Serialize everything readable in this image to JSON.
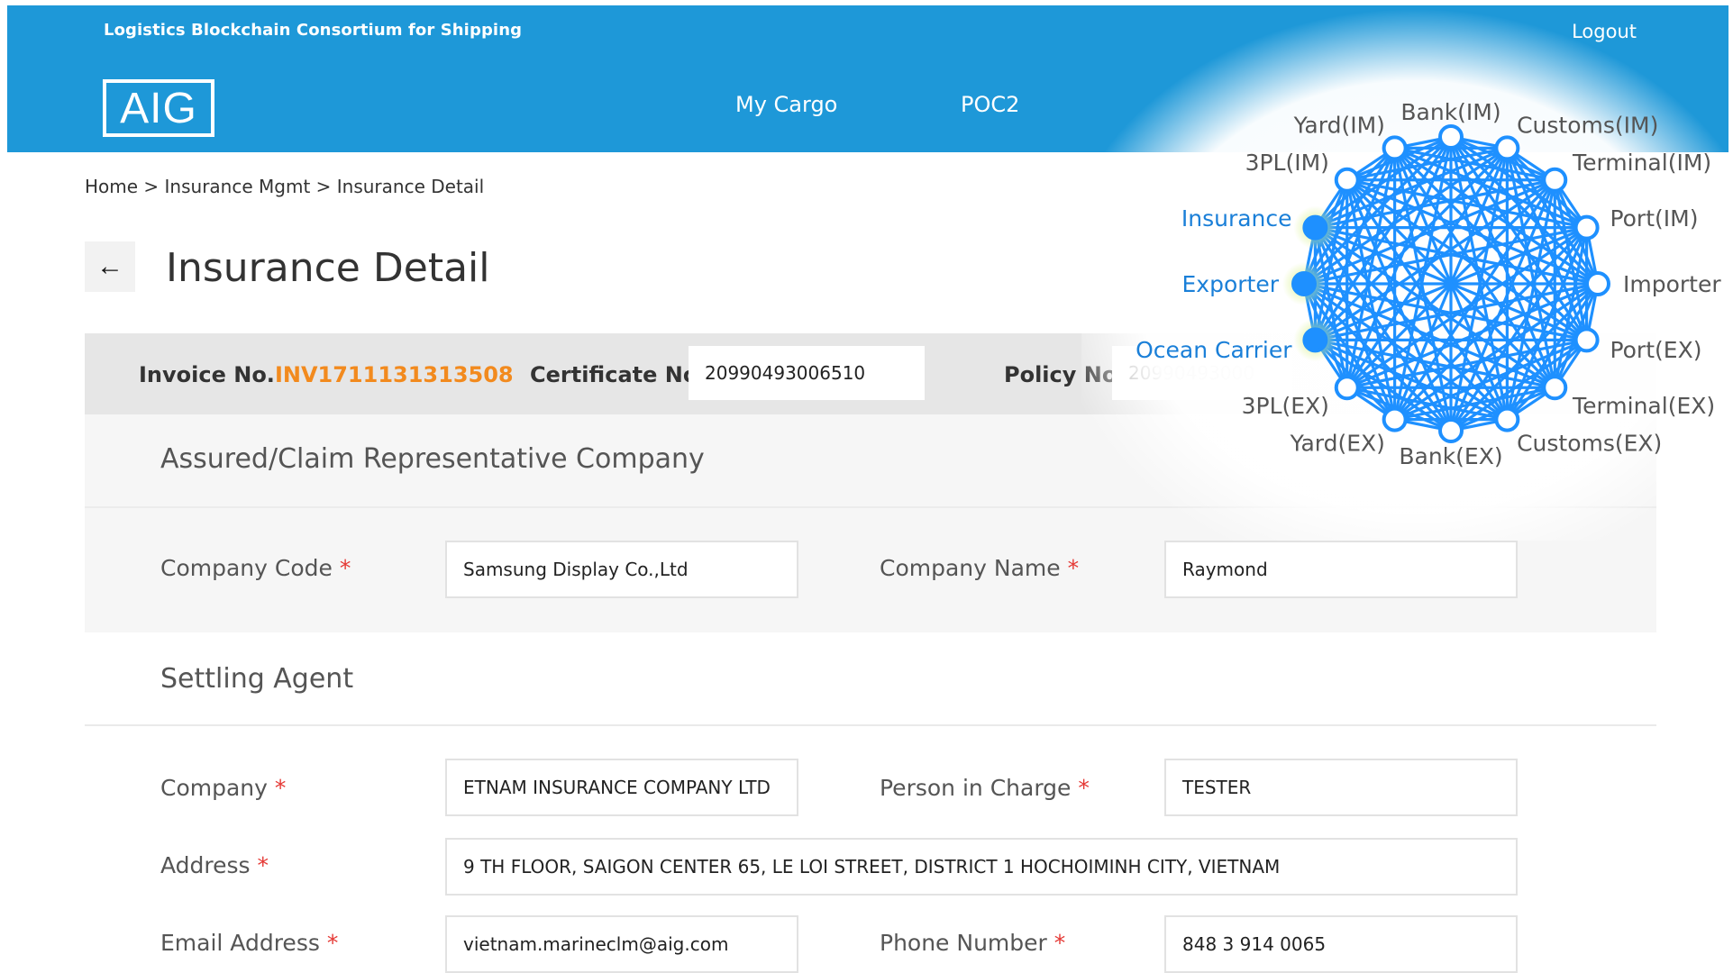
{
  "header": {
    "consortium": "Logistics Blockchain Consortium for Shipping",
    "logout": "Logout",
    "logo": "AIG",
    "nav": [
      "My Cargo",
      "POC2"
    ]
  },
  "breadcrumb": "Home > Insurance Mgmt > Insurance Detail",
  "page_title": "Insurance Detail",
  "back_icon": "←",
  "info_bar": {
    "invoice_label": "Invoice No.",
    "invoice_value": "INV1711131313508",
    "certificate_label": "Certificate No.",
    "certificate_value": "20990493006510",
    "policy_label": "Policy No.",
    "policy_value": "20990493000"
  },
  "assured": {
    "title": "Assured/Claim Representative Company",
    "company_code_label": "Company Code",
    "company_code_value": "Samsung Display Co.,Ltd",
    "company_name_label": "Company Name",
    "company_name_value": "Raymond"
  },
  "settling_agent": {
    "title": "Settling Agent",
    "company_label": "Company",
    "company_value": "ETNAM INSURANCE COMPANY LTD",
    "person_label": "Person in Charge",
    "person_value": "TESTER",
    "address_label": "Address",
    "address_value": "9 TH FLOOR, SAIGON CENTER 65, LE LOI STREET, DISTRICT 1 HOCHOIMINH CITY, VIETNAM",
    "email_label": "Email Address",
    "email_value": "vietnam.marineclm@aig.com",
    "phone_label": "Phone Number",
    "phone_value": "848 3 914 0065"
  },
  "required_mark": "*",
  "network": {
    "nodes": [
      "Bank(IM)",
      "Customs(IM)",
      "Terminal(IM)",
      "Port(IM)",
      "Importer",
      "Port(EX)",
      "Terminal(EX)",
      "Customs(EX)",
      "Bank(EX)",
      "Yard(EX)",
      "3PL(EX)",
      "Ocean Carrier",
      "Exporter",
      "Insurance",
      "3PL(IM)",
      "Yard(IM)"
    ],
    "highlighted": [
      "Ocean Carrier",
      "Exporter",
      "Insurance"
    ],
    "colors": {
      "edge": "#1e90ff",
      "highlight_text": "#1a7fd8",
      "node_text": "#555555",
      "glow": "#d7f08a"
    }
  },
  "colors": {
    "header_bg": "#1e98d8",
    "invoice_accent": "#f28a1e",
    "required": "#e53935"
  }
}
